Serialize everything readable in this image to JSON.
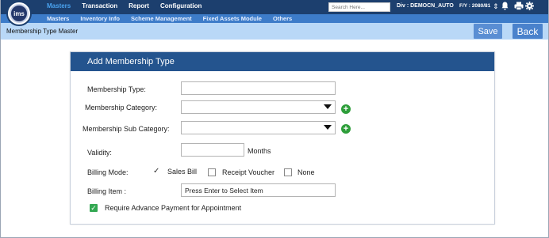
{
  "app": {
    "logo_text": "ims",
    "top_menu": [
      {
        "label": "Masters",
        "active": true
      },
      {
        "label": "Transaction",
        "active": false
      },
      {
        "label": "Report",
        "active": false
      },
      {
        "label": "Configuration",
        "active": false
      }
    ],
    "sub_menu": [
      "Masters",
      "Inventory Info",
      "Scheme Management",
      "Fixed Assets Module",
      "Others"
    ],
    "search": {
      "placeholder": "Search Here..."
    },
    "division": "Div : DEMOCN_AUTO",
    "fiscal_year": "F/Y : 2080/81",
    "icons": [
      "sort-icon",
      "bell-icon",
      "print-icon",
      "settings-icon"
    ]
  },
  "page": {
    "title": "Membership Type Master",
    "save_label": "Save",
    "back_label": "Back"
  },
  "form": {
    "title": "Add Membership Type",
    "membership_type_label": "Membership Type:",
    "membership_type_value": "",
    "membership_category_label": "Membership Category:",
    "membership_category_value": "",
    "membership_sub_category_label": "Membership Sub Category:",
    "membership_sub_category_value": "",
    "validity_label": "Validity:",
    "validity_value": "",
    "validity_unit": "Months",
    "billing_mode_label": "Billing Mode:",
    "billing_modes": [
      {
        "label": "Sales Bill",
        "checked": true
      },
      {
        "label": "Receipt Voucher",
        "checked": false
      },
      {
        "label": "None",
        "checked": false
      }
    ],
    "billing_item_label": "Billing Item :",
    "billing_item_placeholder": "Press Enter to Select Item",
    "advance_payment_label": "Require Advance Payment for Appointment",
    "advance_payment_checked": true
  },
  "colors": {
    "topbar": "#1c3f6e",
    "subbar": "#3d7cc9",
    "pagebar": "#b9d8f7",
    "card_header": "#24548e",
    "button": "#5a8ed3",
    "add_icon": "#2e9e3a"
  }
}
